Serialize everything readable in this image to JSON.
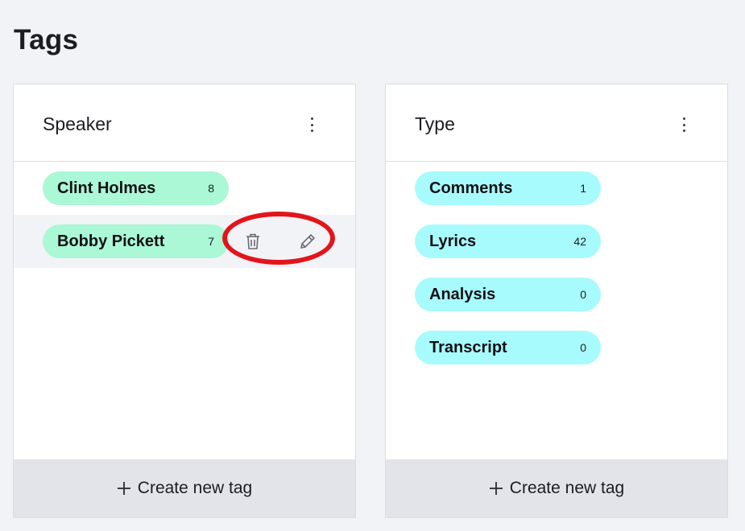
{
  "page": {
    "title": "Tags"
  },
  "groups": [
    {
      "title": "Speaker",
      "color": "#aaf8d6",
      "tags": [
        {
          "name": "Clint Holmes",
          "count": "8"
        },
        {
          "name": "Bobby Pickett",
          "count": "7"
        }
      ],
      "create_label": "Create new tag"
    },
    {
      "title": "Type",
      "color": "#a8fbfd",
      "tags": [
        {
          "name": "Comments",
          "count": "1"
        },
        {
          "name": "Lyrics",
          "count": "42"
        },
        {
          "name": "Analysis",
          "count": "0"
        },
        {
          "name": "Transcript",
          "count": "0"
        }
      ],
      "create_label": "Create new tag"
    }
  ],
  "icons": {
    "kebab": "more-vertical-icon",
    "trash": "trash-icon",
    "edit": "pencil-icon",
    "plus": "plus-icon"
  },
  "highlight_color": "#e3141b"
}
